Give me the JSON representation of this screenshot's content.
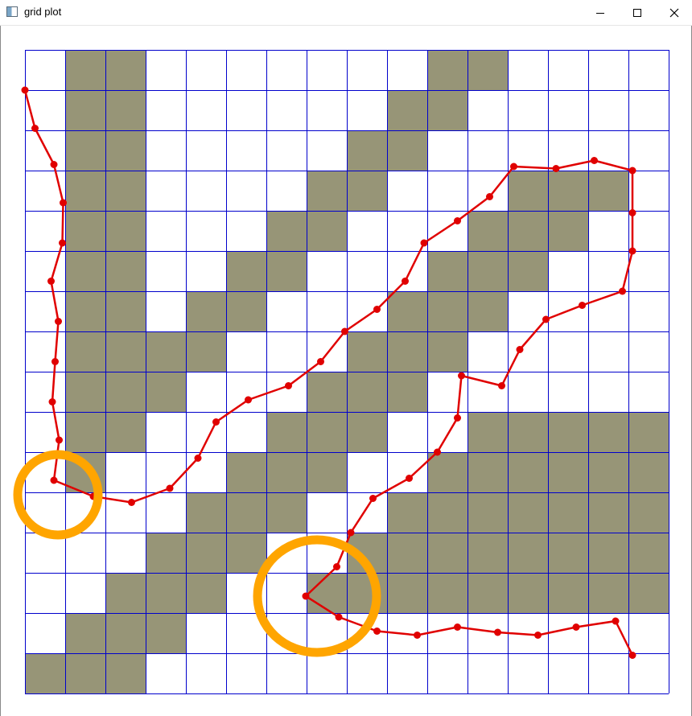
{
  "window": {
    "title": "grid plot",
    "icon": "app-window-icon",
    "controls": [
      "minimize-icon",
      "maximize-icon",
      "close-icon"
    ]
  },
  "grid": {
    "rows": 16,
    "cols": 16,
    "line_color": "#0000cc",
    "obstacle_color": "#979577",
    "free_color": "#ffffff",
    "obstacles": [
      [
        0,
        1
      ],
      [
        0,
        2
      ],
      [
        0,
        10
      ],
      [
        0,
        11
      ],
      [
        1,
        1
      ],
      [
        1,
        2
      ],
      [
        1,
        9
      ],
      [
        1,
        10
      ],
      [
        2,
        1
      ],
      [
        2,
        2
      ],
      [
        2,
        8
      ],
      [
        2,
        9
      ],
      [
        3,
        1
      ],
      [
        3,
        2
      ],
      [
        3,
        7
      ],
      [
        3,
        8
      ],
      [
        3,
        12
      ],
      [
        3,
        13
      ],
      [
        3,
        14
      ],
      [
        4,
        1
      ],
      [
        4,
        2
      ],
      [
        4,
        6
      ],
      [
        4,
        7
      ],
      [
        4,
        11
      ],
      [
        4,
        12
      ],
      [
        4,
        13
      ],
      [
        5,
        1
      ],
      [
        5,
        2
      ],
      [
        5,
        5
      ],
      [
        5,
        6
      ],
      [
        5,
        10
      ],
      [
        5,
        11
      ],
      [
        5,
        12
      ],
      [
        6,
        1
      ],
      [
        6,
        2
      ],
      [
        6,
        4
      ],
      [
        6,
        5
      ],
      [
        6,
        9
      ],
      [
        6,
        10
      ],
      [
        6,
        11
      ],
      [
        7,
        1
      ],
      [
        7,
        2
      ],
      [
        7,
        3
      ],
      [
        7,
        4
      ],
      [
        7,
        8
      ],
      [
        7,
        9
      ],
      [
        7,
        10
      ],
      [
        8,
        1
      ],
      [
        8,
        2
      ],
      [
        8,
        3
      ],
      [
        8,
        7
      ],
      [
        8,
        8
      ],
      [
        8,
        9
      ],
      [
        9,
        1
      ],
      [
        9,
        2
      ],
      [
        9,
        6
      ],
      [
        9,
        7
      ],
      [
        9,
        8
      ],
      [
        9,
        11
      ],
      [
        9,
        12
      ],
      [
        9,
        13
      ],
      [
        9,
        14
      ],
      [
        9,
        15
      ],
      [
        10,
        1
      ],
      [
        10,
        5
      ],
      [
        10,
        6
      ],
      [
        10,
        7
      ],
      [
        10,
        10
      ],
      [
        10,
        11
      ],
      [
        10,
        12
      ],
      [
        10,
        13
      ],
      [
        10,
        14
      ],
      [
        10,
        15
      ],
      [
        11,
        4
      ],
      [
        11,
        5
      ],
      [
        11,
        6
      ],
      [
        11,
        9
      ],
      [
        11,
        10
      ],
      [
        11,
        11
      ],
      [
        11,
        12
      ],
      [
        11,
        13
      ],
      [
        11,
        14
      ],
      [
        11,
        15
      ],
      [
        12,
        3
      ],
      [
        12,
        4
      ],
      [
        12,
        5
      ],
      [
        12,
        8
      ],
      [
        12,
        9
      ],
      [
        12,
        10
      ],
      [
        12,
        11
      ],
      [
        12,
        12
      ],
      [
        12,
        13
      ],
      [
        12,
        14
      ],
      [
        12,
        15
      ],
      [
        13,
        2
      ],
      [
        13,
        3
      ],
      [
        13,
        4
      ],
      [
        13,
        7
      ],
      [
        13,
        8
      ],
      [
        13,
        9
      ],
      [
        13,
        10
      ],
      [
        13,
        11
      ],
      [
        13,
        12
      ],
      [
        13,
        13
      ],
      [
        13,
        14
      ],
      [
        13,
        15
      ],
      [
        14,
        1
      ],
      [
        14,
        2
      ],
      [
        14,
        3
      ],
      [
        15,
        0
      ],
      [
        15,
        1
      ],
      [
        15,
        2
      ]
    ]
  },
  "path": {
    "color": "#e00000",
    "points": [
      [
        0.0,
        1.0
      ],
      [
        0.25,
        1.95
      ],
      [
        0.72,
        2.85
      ],
      [
        0.95,
        3.8
      ],
      [
        0.93,
        4.8
      ],
      [
        0.65,
        5.75
      ],
      [
        0.83,
        6.75
      ],
      [
        0.75,
        7.75
      ],
      [
        0.68,
        8.75
      ],
      [
        0.85,
        9.7
      ],
      [
        0.72,
        10.7
      ],
      [
        1.7,
        11.1
      ],
      [
        2.65,
        11.25
      ],
      [
        3.6,
        10.9
      ],
      [
        4.3,
        10.15
      ],
      [
        4.75,
        9.25
      ],
      [
        5.55,
        8.7
      ],
      [
        6.55,
        8.35
      ],
      [
        7.35,
        7.75
      ],
      [
        7.95,
        7.0
      ],
      [
        8.75,
        6.45
      ],
      [
        9.45,
        5.75
      ],
      [
        9.92,
        4.8
      ],
      [
        10.75,
        4.25
      ],
      [
        11.55,
        3.65
      ],
      [
        12.15,
        2.9
      ],
      [
        13.2,
        2.95
      ],
      [
        14.15,
        2.75
      ],
      [
        15.1,
        3.0
      ],
      [
        15.1,
        4.05
      ],
      [
        15.1,
        5.0
      ],
      [
        14.85,
        6.0
      ],
      [
        13.85,
        6.35
      ],
      [
        12.95,
        6.7
      ],
      [
        12.3,
        7.45
      ],
      [
        11.85,
        8.35
      ],
      [
        10.85,
        8.1
      ],
      [
        10.75,
        9.15
      ],
      [
        10.25,
        10.0
      ],
      [
        9.55,
        10.65
      ],
      [
        8.65,
        11.15
      ],
      [
        8.1,
        12.0
      ],
      [
        7.75,
        12.85
      ],
      [
        6.98,
        13.58
      ],
      [
        7.8,
        14.1
      ],
      [
        8.75,
        14.45
      ],
      [
        9.75,
        14.55
      ],
      [
        10.75,
        14.35
      ],
      [
        11.75,
        14.48
      ],
      [
        12.75,
        14.55
      ],
      [
        13.7,
        14.35
      ],
      [
        14.68,
        14.2
      ],
      [
        15.1,
        15.05
      ]
    ]
  },
  "highlights": {
    "color": "#ffa500",
    "marks": [
      {
        "name": "highlight-circle-near-start"
      },
      {
        "name": "highlight-circle-near-middle"
      }
    ]
  }
}
